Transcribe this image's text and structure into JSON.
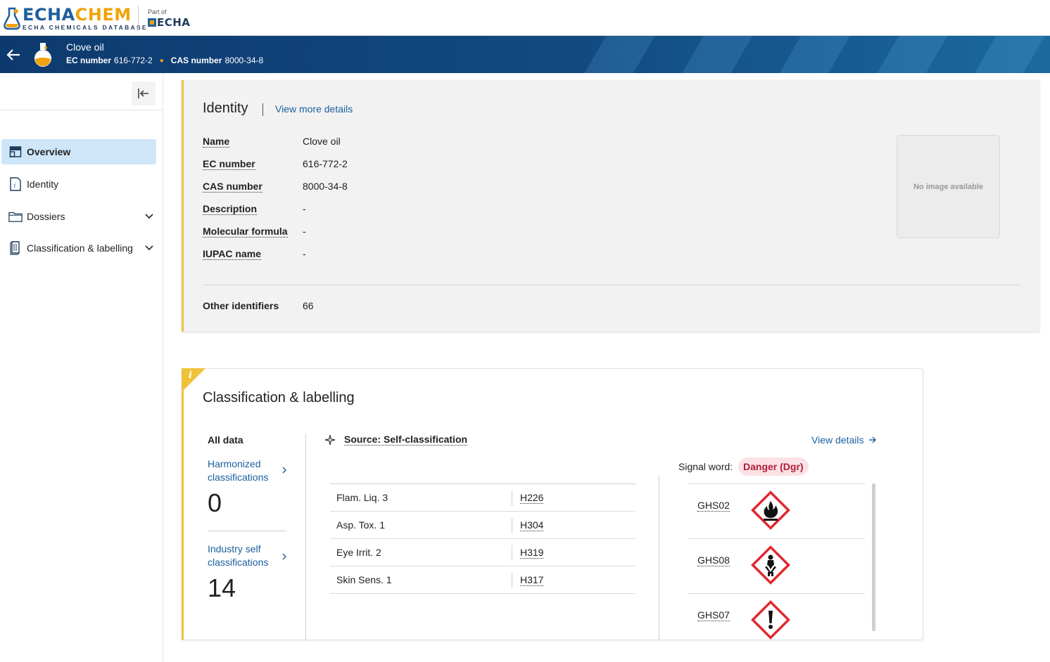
{
  "header": {
    "logo_echa": "ECHA",
    "logo_chem": "CHEM",
    "logo_sub": "ECHA CHEMICALS DATABASE",
    "partof_label": "Part of",
    "partof_org": "ECHA"
  },
  "substance": {
    "name": "Clove oil",
    "ec_label": "EC number",
    "ec_value": "616-772-2",
    "cas_label": "CAS number",
    "cas_value": "8000-34-8"
  },
  "sidebar": {
    "items": [
      {
        "label": "Overview",
        "icon": "overview-icon",
        "active": true
      },
      {
        "label": "Identity",
        "icon": "identity-icon"
      },
      {
        "label": "Dossiers",
        "icon": "folder-icon",
        "expandable": true
      },
      {
        "label": "Classification & labelling",
        "icon": "book-icon",
        "expandable": true
      }
    ]
  },
  "identity": {
    "title": "Identity",
    "view_more": "View more details",
    "rows": [
      {
        "label": "Name",
        "value": "Clove oil"
      },
      {
        "label": "EC number",
        "value": "616-772-2"
      },
      {
        "label": "CAS number",
        "value": "8000-34-8"
      },
      {
        "label": "Description",
        "value": "-"
      },
      {
        "label": "Molecular formula",
        "value": "-"
      },
      {
        "label": "IUPAC name",
        "value": "-"
      }
    ],
    "no_image": "No image available",
    "other_identifiers_label": "Other identifiers",
    "other_identifiers_value": "66"
  },
  "classification": {
    "title": "Classification & labelling",
    "all_data": "All data",
    "harmonized_label": "Harmonized classifications",
    "harmonized_count": "0",
    "industry_label": "Industry self classifications",
    "industry_count": "14",
    "source": "Source: Self-classification",
    "view_details": "View details",
    "hazards": [
      {
        "class": "Flam. Liq. 3",
        "code": "H226"
      },
      {
        "class": "Asp. Tox. 1",
        "code": "H304"
      },
      {
        "class": "Eye Irrit. 2",
        "code": "H319"
      },
      {
        "class": "Skin Sens. 1",
        "code": "H317"
      }
    ],
    "signal_word_label": "Signal word:",
    "signal_word": "Danger (Dgr)",
    "pictograms": [
      {
        "code": "GHS02",
        "icon": "flame-pictogram-icon"
      },
      {
        "code": "GHS08",
        "icon": "health-hazard-pictogram-icon"
      },
      {
        "code": "GHS07",
        "icon": "exclamation-pictogram-icon"
      }
    ]
  },
  "colors": {
    "brand_blue": "#1f5e9c",
    "brand_orange": "#f0a30a",
    "accent_yellow": "#f0c23a",
    "link_blue": "#1a5f9e",
    "danger_red": "#b31b3c",
    "ghs_red": "#e0282e"
  }
}
